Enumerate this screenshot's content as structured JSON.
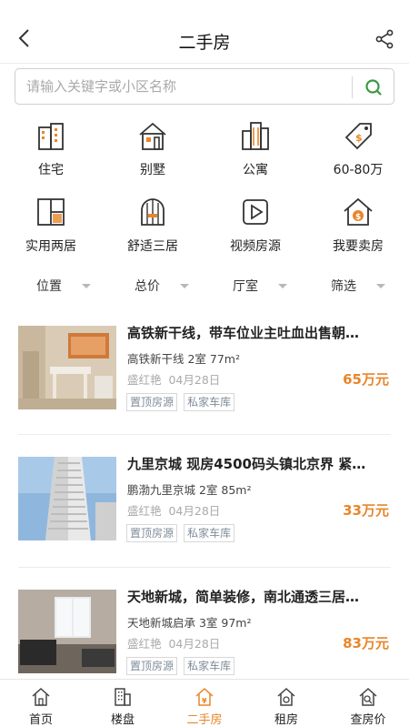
{
  "header": {
    "title": "二手房",
    "back_icon": "chevron-left-icon",
    "share_icon": "share-icon"
  },
  "search": {
    "placeholder": "请输入关键字或小区名称",
    "value": "",
    "icon": "search-icon",
    "icon_color": "#3a9a3f"
  },
  "categories": [
    {
      "label": "住宅",
      "icon": "residence-icon"
    },
    {
      "label": "别墅",
      "icon": "villa-icon"
    },
    {
      "label": "公寓",
      "icon": "apartment-icon"
    },
    {
      "label": "60-80万",
      "icon": "price-tag-icon"
    },
    {
      "label": "实用两居",
      "icon": "two-room-icon"
    },
    {
      "label": "舒适三居",
      "icon": "three-room-icon"
    },
    {
      "label": "视频房源",
      "icon": "video-icon"
    },
    {
      "label": "我要卖房",
      "icon": "sell-house-icon"
    }
  ],
  "filters": [
    {
      "label": "位置"
    },
    {
      "label": "总价"
    },
    {
      "label": "厅室"
    },
    {
      "label": "筛选"
    }
  ],
  "listings": [
    {
      "title": "高铁新干线，带车位业主吐血出售朝…",
      "detail": "高铁新干线 2室 77m²",
      "agent": "盛红艳",
      "date": "04月28日",
      "price": "65万元",
      "tags": [
        "置顶房源",
        "私家车库"
      ]
    },
    {
      "title": "九里京城 现房4500码头镇北京界 紧…",
      "detail": "鹏渤九里京城 2室 85m²",
      "agent": "盛红艳",
      "date": "04月28日",
      "price": "33万元",
      "tags": [
        "置顶房源",
        "私家车库"
      ]
    },
    {
      "title": "天地新城，简单装修，南北通透三居…",
      "detail": "天地新城启承 3室 97m²",
      "agent": "盛红艳",
      "date": "04月28日",
      "price": "83万元",
      "tags": [
        "置顶房源",
        "私家车库"
      ]
    }
  ],
  "bottom_nav": [
    {
      "label": "首页",
      "icon": "home-icon"
    },
    {
      "label": "楼盘",
      "icon": "building-icon"
    },
    {
      "label": "二手房",
      "icon": "secondhand-house-icon",
      "active": true
    },
    {
      "label": "租房",
      "icon": "rent-icon"
    },
    {
      "label": "查房价",
      "icon": "price-search-icon"
    }
  ],
  "colors": {
    "accent": "#e8862a",
    "search_green": "#3a9a3f",
    "tag_text": "#7f8c9a"
  }
}
